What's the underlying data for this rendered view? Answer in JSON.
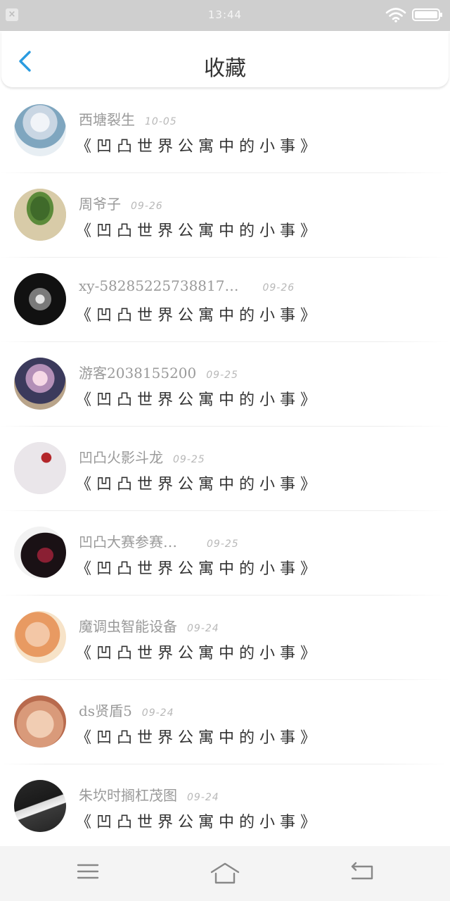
{
  "status_bar": {
    "time": "13:44",
    "close_glyph": "×"
  },
  "header": {
    "title": "收藏",
    "back_icon": "chevron-left-icon",
    "accent": "#2a9be0"
  },
  "items": [
    {
      "name": "西塘裂生",
      "date": "10-05",
      "title": "《凹凸世界公寓中的小事》",
      "avatar": "anime-boy-avatar"
    },
    {
      "name": "周爷子",
      "date": "09-26",
      "title": "《凹凸世界公寓中的小事》",
      "avatar": "bonsai-avatar"
    },
    {
      "name": "xy-58285225738817…",
      "date": "09-26",
      "title": "《凹凸世界公寓中的小事》",
      "avatar": "bw-photo-avatar"
    },
    {
      "name": "游客2038155200",
      "date": "09-25",
      "title": "《凹凸世界公寓中的小事》",
      "avatar": "book-heart-avatar"
    },
    {
      "name": "凹凸火影斗龙",
      "date": "09-25",
      "title": "《凹凸世界公寓中的小事》",
      "avatar": "red-flower-avatar"
    },
    {
      "name": "凹凸大赛参赛…",
      "date": "09-25",
      "title": "《凹凸世界公寓中的小事》",
      "avatar": "anime-girl-avatar"
    },
    {
      "name": "魔调虫智能设备",
      "date": "09-24",
      "title": "《凹凸世界公寓中的小事》",
      "avatar": "baby-avatar"
    },
    {
      "name": "ds贤盾5",
      "date": "09-24",
      "title": "《凹凸世界公寓中的小事》",
      "avatar": "baby-feet-avatar"
    },
    {
      "name": "朱坎时搁杠茂图",
      "date": "09-24",
      "title": "《凹凸世界公寓中的小事》",
      "avatar": "cigarette-avatar"
    }
  ],
  "bottom_nav": {
    "menu_icon": "menu-icon",
    "home_icon": "home-icon",
    "back_icon": "back-arrow-icon"
  }
}
